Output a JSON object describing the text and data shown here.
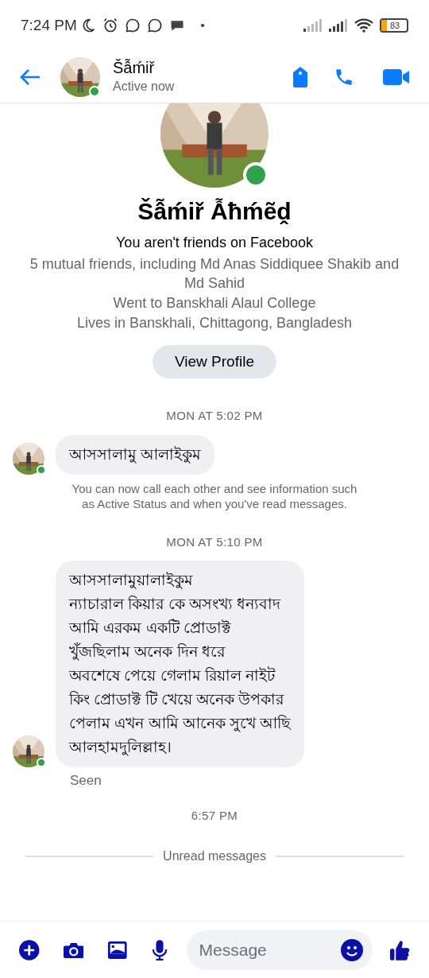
{
  "status_bar": {
    "time": "7:24 PM",
    "battery": "83"
  },
  "header": {
    "name": "Šẫḿiř",
    "status": "Active now",
    "online": true
  },
  "profile": {
    "name": "Šẫḿiř Ẫħḿẽḓ",
    "online": true,
    "friendship": "You aren't friends on Facebook",
    "details": [
      "5 mutual friends, including Md Anas Siddiquee Shakib and Md Sahid",
      "Went to Banskhali Alaul College",
      "Lives in Banskhali, Chittagong, Bangladesh"
    ],
    "button": "View Profile"
  },
  "conversation": [
    {
      "kind": "timestamp",
      "text": "MON AT 5:02 PM"
    },
    {
      "kind": "message",
      "text": "আসসালামু আলাইকুম",
      "avatar": true,
      "online": true
    },
    {
      "kind": "notice",
      "text": "You can now call each other and see information such as Active Status and when you've read messages."
    },
    {
      "kind": "timestamp",
      "text": "MON AT 5:10 PM"
    },
    {
      "kind": "message",
      "text": "আসসালামুয়ালাইকুম\nন্যাচারাল কিয়ার কে অসংখ্য ধন্যবাদ\nআমি এরকম একটি প্রোডাক্ট\nখুঁজছিলাম অনেক দিন ধরে\nঅবশেষে পেয়ে গেলাম রিয়াল নাইট\nকিং প্রোডাক্ট টি খেয়ে অনেক উপকার\nপেলাম এখন আমি আনেক সুখে আছি\nআলহামদুলিল্লাহ।",
      "avatar": true,
      "online": true
    },
    {
      "kind": "receipt",
      "text": "Seen"
    },
    {
      "kind": "timestamp",
      "text": "6:57 PM"
    },
    {
      "kind": "divider",
      "text": "Unread messages"
    }
  ],
  "composer": {
    "placeholder": "Message"
  }
}
